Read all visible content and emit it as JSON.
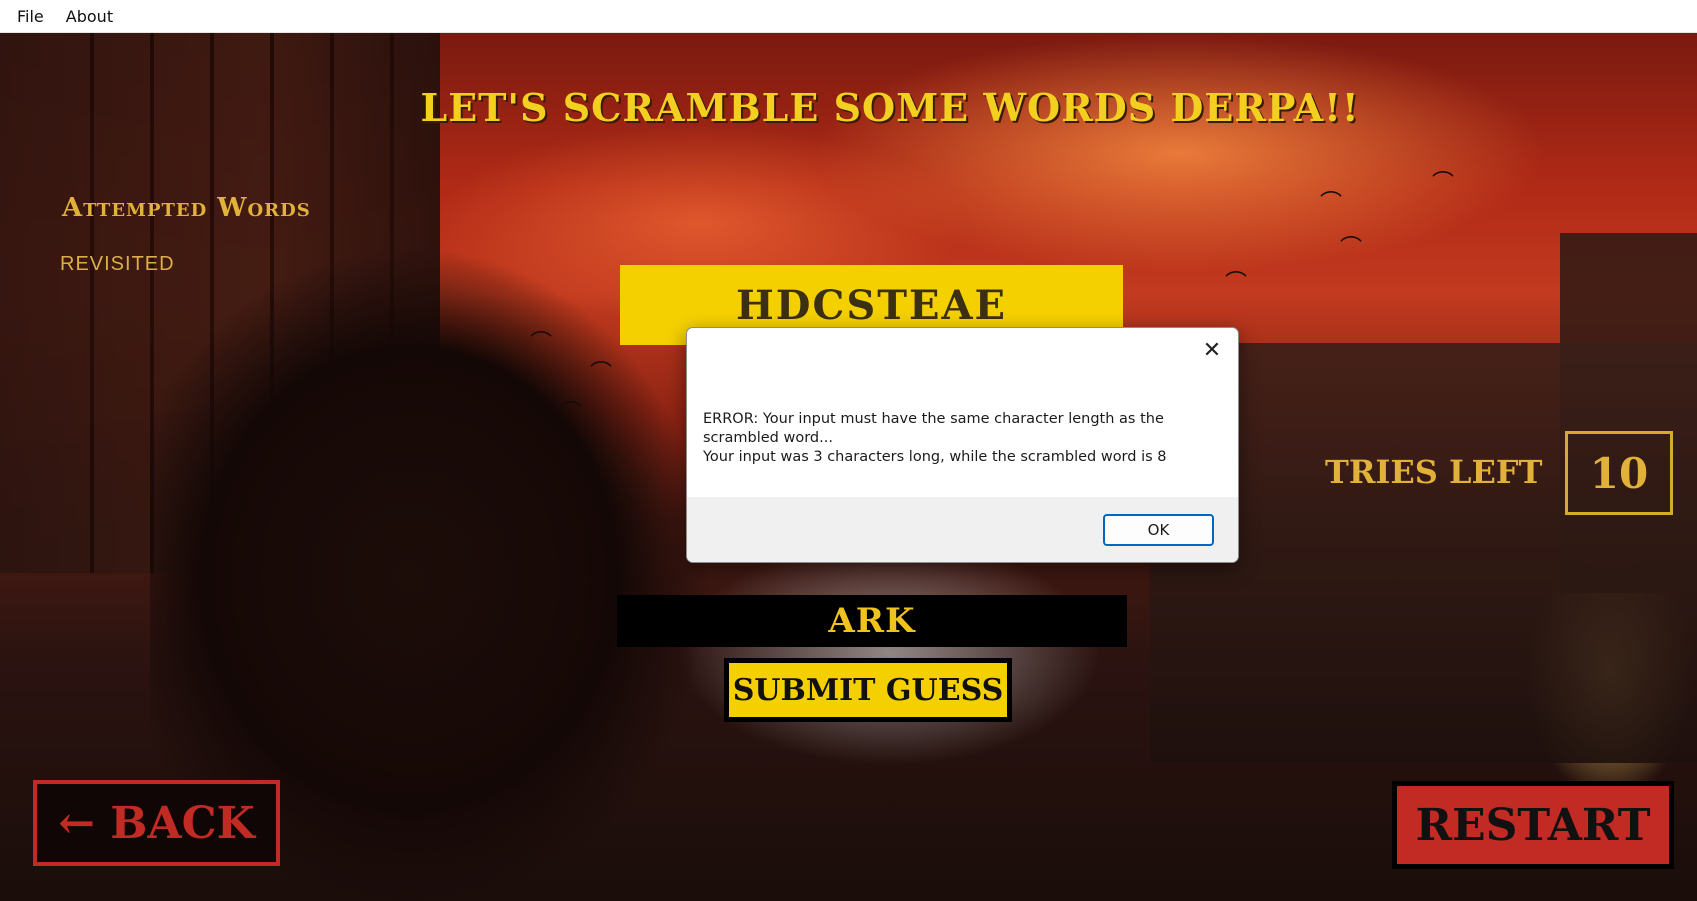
{
  "menubar": {
    "items": [
      "File",
      "About"
    ]
  },
  "game": {
    "title": "LET'S SCRAMBLE SOME WORDS DERPA!!",
    "attempted_heading": "Attempted Words",
    "attempted_words": [
      "REVISITED"
    ],
    "scrambled_word": "HDCSTEAE",
    "tries_label": "TRIES LEFT",
    "tries_value": "10",
    "guess_value": "ARK",
    "submit_label": "SUBMIT GUESS",
    "back_label": "← BACK",
    "restart_label": "RESTART"
  },
  "dialog": {
    "close_glyph": "✕",
    "message_line1": "ERROR: Your input must have the same character length as the scrambled word...",
    "message_line2": "Your input was 3 characters long, while the scrambled word is 8",
    "ok_label": "OK"
  },
  "colors": {
    "accent_yellow": "#f5d000",
    "label_gold": "#e2b13a",
    "button_red": "#c22a24",
    "dialog_ok_border": "#0067c0"
  }
}
